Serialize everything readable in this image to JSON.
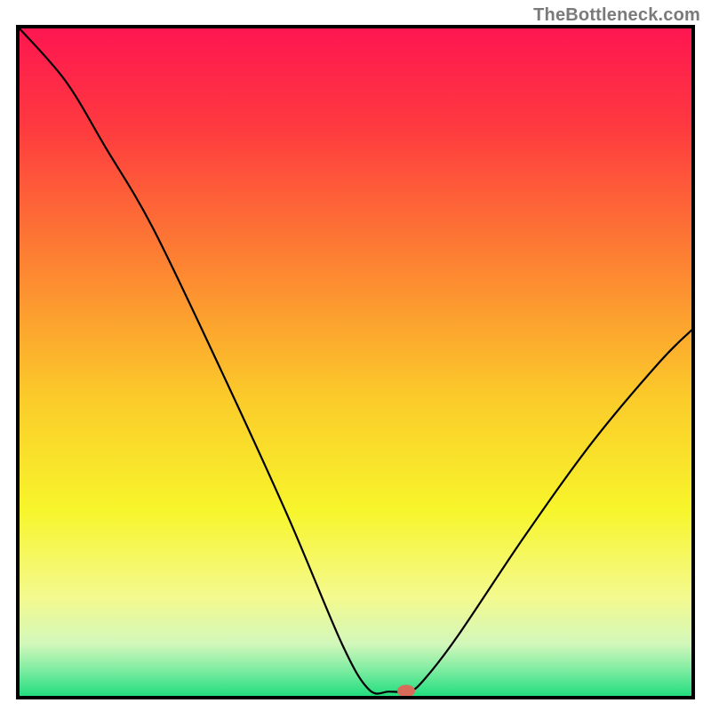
{
  "attribution": "TheBottleneck.com",
  "chart_data": {
    "type": "line",
    "title": "",
    "xlabel": "",
    "ylabel": "",
    "xlim": [
      0,
      100
    ],
    "ylim": [
      0,
      100
    ],
    "curve": [
      {
        "x": 0,
        "y": 100
      },
      {
        "x": 7,
        "y": 92
      },
      {
        "x": 13,
        "y": 82
      },
      {
        "x": 20,
        "y": 70
      },
      {
        "x": 30,
        "y": 49
      },
      {
        "x": 40,
        "y": 27
      },
      {
        "x": 48,
        "y": 8
      },
      {
        "x": 52,
        "y": 1.2
      },
      {
        "x": 55,
        "y": 0.9
      },
      {
        "x": 58,
        "y": 1.0
      },
      {
        "x": 60,
        "y": 2.5
      },
      {
        "x": 65,
        "y": 9
      },
      {
        "x": 75,
        "y": 24
      },
      {
        "x": 85,
        "y": 38
      },
      {
        "x": 95,
        "y": 50
      },
      {
        "x": 100,
        "y": 55
      }
    ],
    "marker": {
      "x": 57.5,
      "y": 1.0
    },
    "marker_color": "#d96b5a",
    "gradient_stops": [
      {
        "offset": 0.0,
        "color": "#fe1551"
      },
      {
        "offset": 0.15,
        "color": "#fe3a3f"
      },
      {
        "offset": 0.35,
        "color": "#fd8232"
      },
      {
        "offset": 0.55,
        "color": "#fbca2a"
      },
      {
        "offset": 0.72,
        "color": "#f7f52b"
      },
      {
        "offset": 0.85,
        "color": "#f4fa8e"
      },
      {
        "offset": 0.92,
        "color": "#d2f7bb"
      },
      {
        "offset": 0.96,
        "color": "#7beca0"
      },
      {
        "offset": 1.0,
        "color": "#1bdc7c"
      }
    ],
    "frame_color": "#000000",
    "curve_color": "#000000"
  }
}
